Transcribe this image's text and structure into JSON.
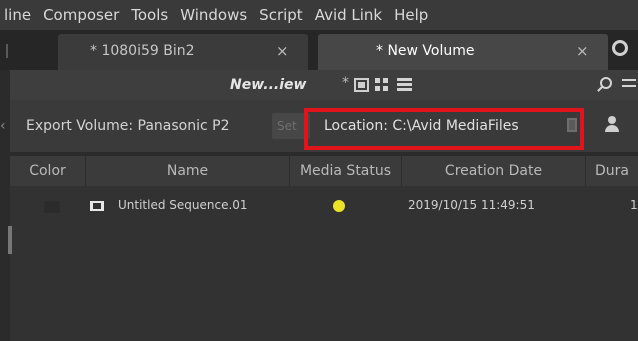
{
  "menubar": {
    "items": [
      "line",
      "Composer",
      "Tools",
      "Windows",
      "Script",
      "Avid Link",
      "Help"
    ]
  },
  "tabs": [
    {
      "label": "* 1080i59 Bin2",
      "close": "×"
    },
    {
      "label": "* New Volume",
      "close": "×"
    }
  ],
  "bin": {
    "title": "New...iew",
    "title_marker": "*"
  },
  "info": {
    "export_label": "Export Volume: Panasonic P2",
    "set_button": "Set",
    "location_label": "Location: C:\\Avid MediaFiles"
  },
  "table": {
    "headers": [
      "Color",
      "Name",
      "Media Status",
      "Creation Date",
      "Dura"
    ],
    "rows": [
      {
        "name": "Untitled Sequence.01",
        "media_status": "online",
        "media_status_color": "#ece325",
        "creation_date": "2019/10/15 11:49:51",
        "duration": "1"
      }
    ]
  },
  "colors": {
    "highlight": "#e0141a",
    "status_online": "#ece325"
  }
}
